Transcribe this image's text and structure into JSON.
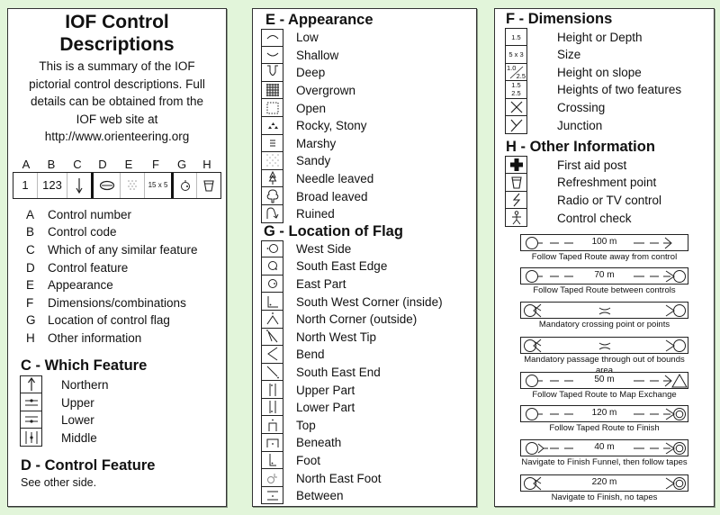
{
  "intro_panel": {
    "title_line1": "IOF Control",
    "title_line2": "Descriptions",
    "intro_lines": [
      "This is a summary of the IOF",
      "pictorial control descriptions. Full",
      "details can be obtained from the",
      "IOF web site at",
      "http://www.orienteering.org"
    ],
    "column_letters": [
      "A",
      "B",
      "C",
      "D",
      "E",
      "F",
      "G",
      "H"
    ],
    "example_row": {
      "a": "1",
      "b": "123",
      "c": "down-arrow-icon",
      "d": "ellipse-feature-icon",
      "e": "sandy-icon",
      "f": "15 x 5",
      "g": "east-part-icon",
      "h": "cup-icon"
    },
    "legend": [
      {
        "key": "A",
        "label": "Control number"
      },
      {
        "key": "B",
        "label": "Control code"
      },
      {
        "key": "C",
        "label": "Which of any similar feature"
      },
      {
        "key": "D",
        "label": "Control feature"
      },
      {
        "key": "E",
        "label": "Appearance"
      },
      {
        "key": "F",
        "label": "Dimensions/combinations"
      },
      {
        "key": "G",
        "label": "Location of control flag"
      },
      {
        "key": "H",
        "label": "Other information"
      }
    ]
  },
  "which_feature": {
    "heading": "C - Which Feature",
    "items": [
      {
        "icon": "up-arrow-icon",
        "label": "Northern"
      },
      {
        "icon": "upper-icon",
        "label": "Upper"
      },
      {
        "icon": "lower-icon",
        "label": "Lower"
      },
      {
        "icon": "middle-icon",
        "label": "Middle"
      }
    ]
  },
  "control_feature": {
    "heading": "D - Control Feature",
    "text": "See other side."
  },
  "appearance": {
    "heading": "E - Appearance",
    "items": [
      {
        "icon": "low-icon",
        "label": "Low"
      },
      {
        "icon": "shallow-icon",
        "label": "Shallow"
      },
      {
        "icon": "deep-icon",
        "label": "Deep"
      },
      {
        "icon": "overgrown-icon",
        "label": "Overgrown"
      },
      {
        "icon": "open-icon",
        "label": "Open"
      },
      {
        "icon": "rocky-icon",
        "label": "Rocky, Stony"
      },
      {
        "icon": "marshy-icon",
        "label": "Marshy"
      },
      {
        "icon": "sandy-icon",
        "label": "Sandy"
      },
      {
        "icon": "needle-leaved-icon",
        "label": "Needle leaved"
      },
      {
        "icon": "broad-leaved-icon",
        "label": "Broad leaved"
      },
      {
        "icon": "ruined-icon",
        "label": "Ruined"
      }
    ]
  },
  "location": {
    "heading": "G - Location of Flag",
    "items": [
      {
        "icon": "west-side-icon",
        "label": "West Side"
      },
      {
        "icon": "south-east-edge-icon",
        "label": "South East Edge"
      },
      {
        "icon": "east-part-icon",
        "label": "East Part"
      },
      {
        "icon": "south-west-corner-inside-icon",
        "label": "South West Corner (inside)"
      },
      {
        "icon": "north-corner-outside-icon",
        "label": "North Corner (outside)"
      },
      {
        "icon": "north-west-tip-icon",
        "label": "North West Tip"
      },
      {
        "icon": "bend-icon",
        "label": "Bend"
      },
      {
        "icon": "south-east-end-icon",
        "label": "South East End"
      },
      {
        "icon": "upper-part-icon",
        "label": "Upper Part"
      },
      {
        "icon": "lower-part-icon",
        "label": "Lower Part"
      },
      {
        "icon": "top-icon",
        "label": "Top"
      },
      {
        "icon": "beneath-icon",
        "label": "Beneath"
      },
      {
        "icon": "foot-icon",
        "label": "Foot"
      },
      {
        "icon": "north-east-foot-icon",
        "label": "North East Foot"
      },
      {
        "icon": "between-icon",
        "label": "Between"
      }
    ]
  },
  "dimensions": {
    "heading": "F - Dimensions",
    "items": [
      {
        "symbol": "1.5",
        "label": "Height or Depth"
      },
      {
        "symbol": "5 x 3",
        "label": "Size"
      },
      {
        "symbol_top": "1.0",
        "symbol_bottom": "2.5",
        "label": "Height on slope"
      },
      {
        "symbol_top": "1.5",
        "symbol_bottom": "2.5",
        "label": "Heights of two features"
      },
      {
        "icon": "crossing-icon",
        "label": "Crossing"
      },
      {
        "icon": "junction-icon",
        "label": "Junction"
      }
    ]
  },
  "other_info": {
    "heading": "H - Other Information",
    "items": [
      {
        "icon": "first-aid-icon",
        "label": "First aid post"
      },
      {
        "icon": "refreshment-icon",
        "label": "Refreshment point"
      },
      {
        "icon": "radio-icon",
        "label": "Radio or TV control"
      },
      {
        "icon": "control-check-icon",
        "label": "Control check"
      }
    ]
  },
  "taped_routes": [
    {
      "distance": "100 m",
      "caption": "Follow Taped Route away from control"
    },
    {
      "distance": "70 m",
      "caption": "Follow Taped Route between controls"
    },
    {
      "distance": "",
      "caption": "Mandatory crossing point or points"
    },
    {
      "distance": "",
      "caption": "Mandatory passage through out of bounds area"
    },
    {
      "distance": "50 m",
      "caption": "Follow Taped Route to Map Exchange"
    },
    {
      "distance": "120 m",
      "caption": "Follow Taped Route to Finish"
    },
    {
      "distance": "40 m",
      "caption": "Navigate to Finish Funnel, then follow tapes"
    },
    {
      "distance": "220 m",
      "caption": "Navigate to Finish, no tapes"
    }
  ]
}
